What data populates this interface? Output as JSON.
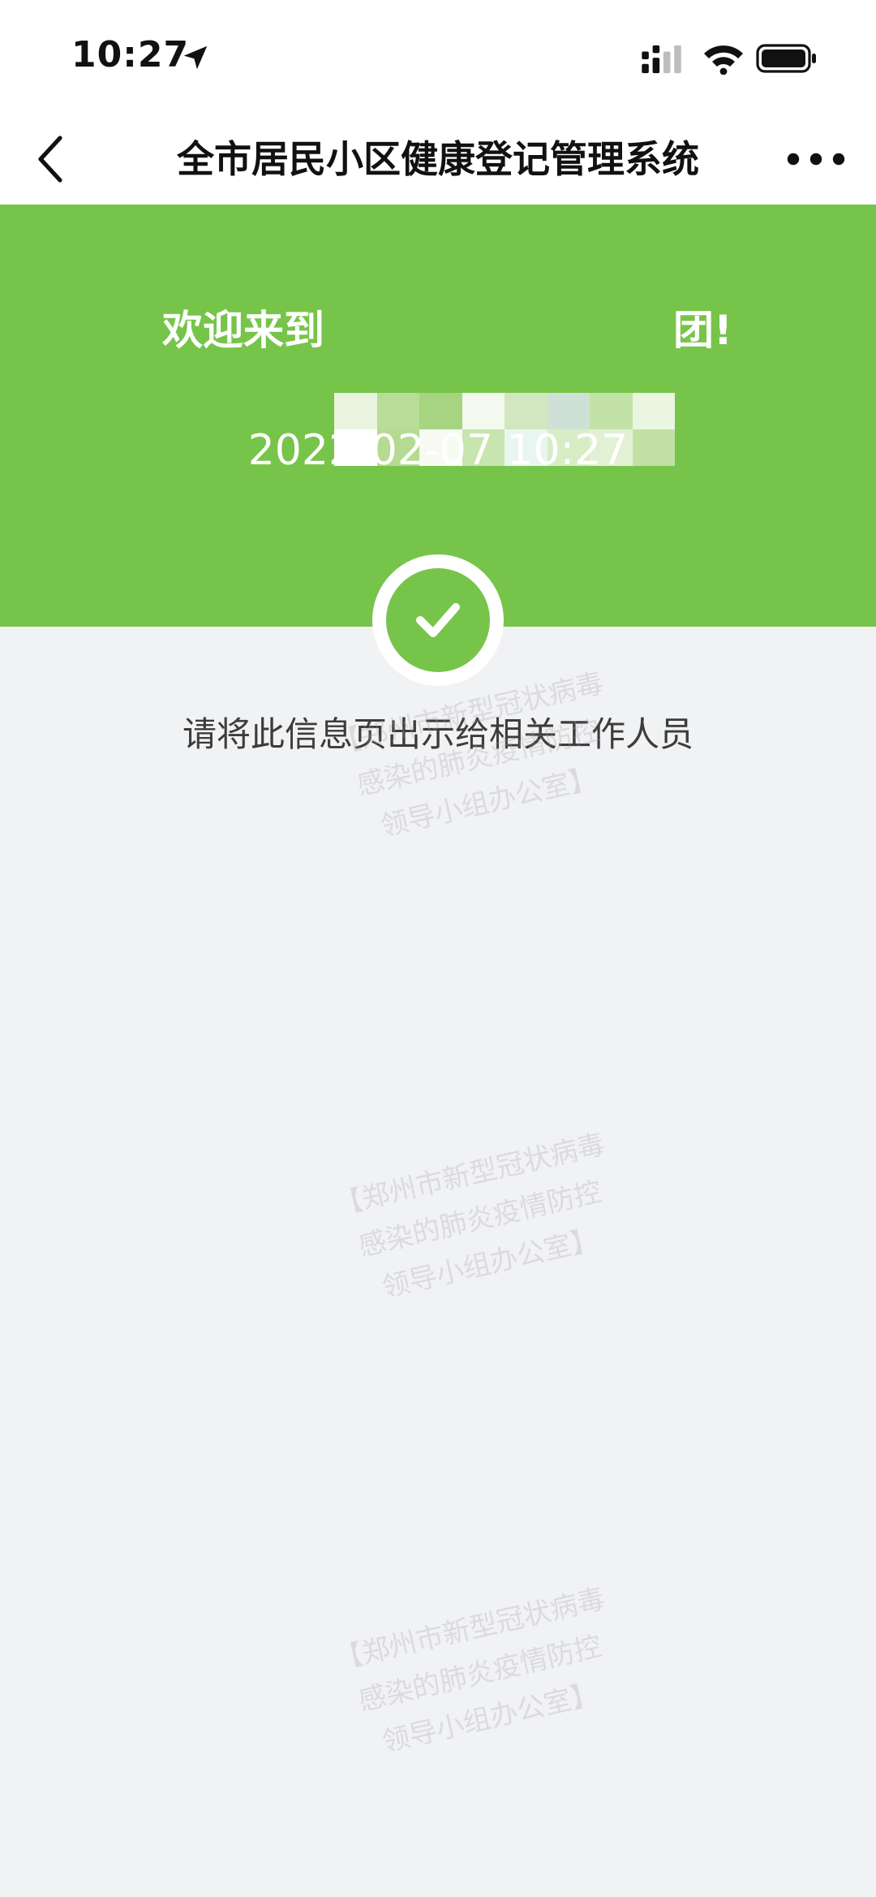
{
  "status_bar": {
    "time": "10:27",
    "icons": [
      "location-arrow-icon",
      "signal-icon",
      "wifi-icon",
      "battery-icon"
    ]
  },
  "nav": {
    "title": "全市居民小区健康登记管理系统",
    "back_icon": "chevron-left-icon",
    "more_icon": "more-dots-icon"
  },
  "banner": {
    "welcome_prefix": "欢迎来到",
    "welcome_suffix": "团!",
    "datetime": "2022-02-07 10:27",
    "background_color": "#77c44a"
  },
  "badge": {
    "icon": "checkmark-icon"
  },
  "instruction": "请将此信息页出示给相关工作人员",
  "watermark": {
    "line1": "【郑州市新型冠状病毒",
    "line2": "感染的肺炎疫情防控",
    "line3": "领导小组办公室】"
  }
}
